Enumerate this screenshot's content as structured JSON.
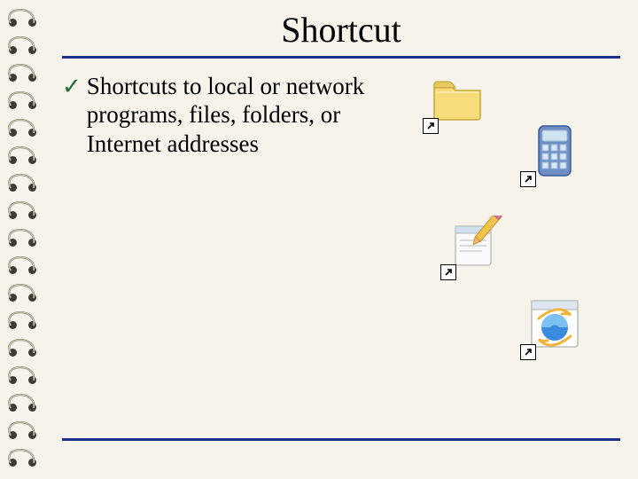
{
  "title": "Shortcut",
  "bullet": {
    "marker": "✓",
    "text": "Shortcuts to local or network programs, files, folders, or Internet addresses"
  },
  "icons": {
    "folder": "folder-icon",
    "calculator": "calculator-icon",
    "notepad": "notepad-icon",
    "internet_explorer": "ie-icon"
  }
}
